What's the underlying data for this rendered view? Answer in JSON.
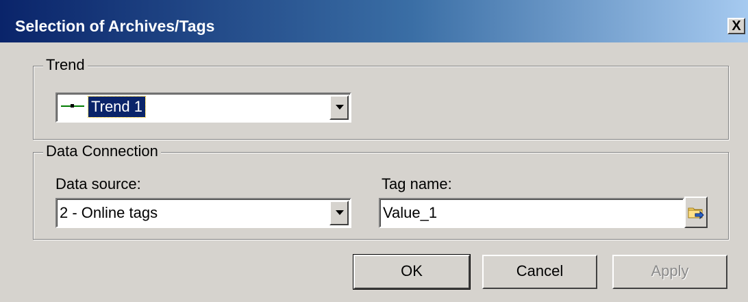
{
  "window": {
    "title": "Selection of Archives/Tags",
    "close_label": "X"
  },
  "trend_group": {
    "legend": "Trend",
    "selected_trend": "Trend 1",
    "trend_color": "#007a00"
  },
  "data_connection": {
    "legend": "Data Connection",
    "data_source_label": "Data source:",
    "data_source_value": "2 - Online tags",
    "tag_name_label": "Tag name:",
    "tag_name_value": "Value_1",
    "browse_icon": "folder-browse-icon"
  },
  "buttons": {
    "ok": "OK",
    "cancel": "Cancel",
    "apply": "Apply"
  },
  "colors": {
    "titlebar_start": "#0a246a",
    "titlebar_end": "#a6caf0",
    "dialog_bg": "#d6d3ce"
  }
}
